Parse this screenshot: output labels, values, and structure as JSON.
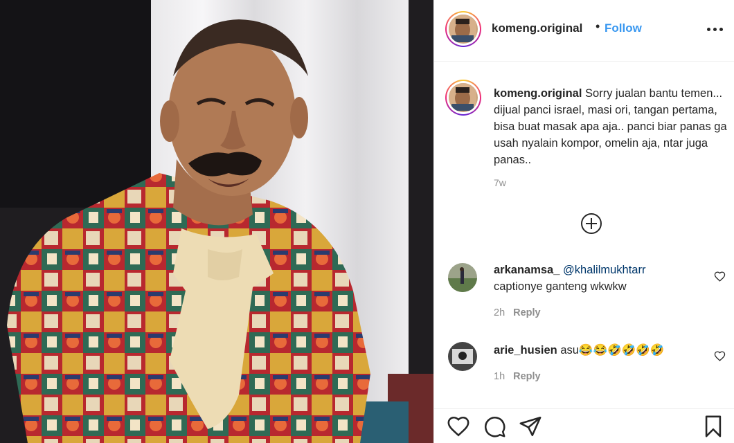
{
  "post": {
    "username": "komeng.original",
    "separator": "•",
    "follow_label": "Follow",
    "more_icon": "more-options-icon"
  },
  "caption": {
    "username": "komeng.original",
    "text": "Sorry jualan bantu temen... dijual panci israel, masi ori, tangan pertama, bisa buat masak apa aja.. panci biar panas ga usah nyalain kompor, omelin aja, ntar juga panas..",
    "time": "7w"
  },
  "load_more_icon": "plus-circle-icon",
  "comments": [
    {
      "username": "arkanamsa_",
      "mention": "@khalilmukhtarr",
      "text": "captionye ganteng wkwkw",
      "time": "2h",
      "reply_label": "Reply"
    },
    {
      "username": "arie_husien",
      "text": "asu😂😂🤣🤣🤣🤣",
      "time": "1h",
      "reply_label": "Reply"
    }
  ],
  "actions": [
    "heart-icon",
    "comment-icon",
    "share-icon",
    "bookmark-icon"
  ],
  "colors": {
    "link": "#3897f0",
    "mention": "#00376b",
    "text": "#262626",
    "muted": "#8e8e8e",
    "border": "#efefef"
  }
}
